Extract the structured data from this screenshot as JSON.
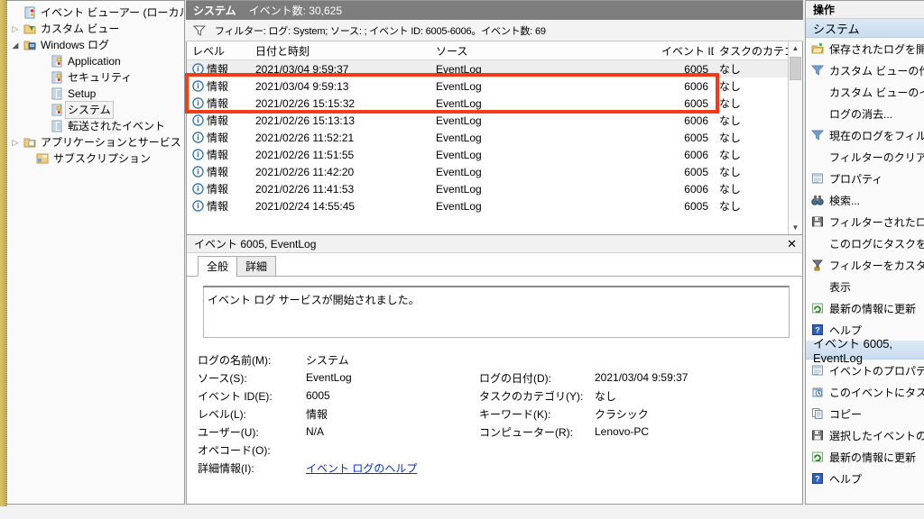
{
  "tree": {
    "items": [
      {
        "label": "イベント ビューアー (ローカル)",
        "icon": "event-viewer-icon",
        "indent": 1,
        "twisty": "none",
        "selected": false
      },
      {
        "label": "カスタム ビュー",
        "icon": "custom-view-folder-icon",
        "indent": 1,
        "twisty": "closed",
        "selected": false
      },
      {
        "label": "Windows ログ",
        "icon": "windows-log-folder-icon",
        "indent": 1,
        "twisty": "open",
        "selected": false
      },
      {
        "label": "Application",
        "icon": "log-icon",
        "indent": 3,
        "twisty": "none",
        "selected": false
      },
      {
        "label": "セキュリティ",
        "icon": "log-icon",
        "indent": 3,
        "twisty": "none",
        "selected": false
      },
      {
        "label": "Setup",
        "icon": "plain-log-icon",
        "indent": 3,
        "twisty": "none",
        "selected": false
      },
      {
        "label": "システム",
        "icon": "log-icon",
        "indent": 3,
        "twisty": "none",
        "selected": true
      },
      {
        "label": "転送されたイベント",
        "icon": "plain-log-icon",
        "indent": 3,
        "twisty": "none",
        "selected": false
      },
      {
        "label": "アプリケーションとサービス ログ",
        "icon": "app-service-folder-icon",
        "indent": 1,
        "twisty": "closed",
        "selected": false
      },
      {
        "label": "サブスクリプション",
        "icon": "subscription-icon",
        "indent": 2,
        "twisty": "none",
        "selected": false
      }
    ]
  },
  "center": {
    "header_title": "システム",
    "header_count": "イベント数: 30,625",
    "filter_icon": "filter-icon",
    "filter_text": "フィルター: ログ: System; ソース: ; イベント ID: 6005-6006。イベント数: 69",
    "columns": [
      "レベル",
      "日付と時刻",
      "ソース",
      "イベント ID",
      "タスクのカテゴリ"
    ],
    "rows": [
      {
        "level": "情報",
        "date": "2021/03/04 9:59:37",
        "source": "EventLog",
        "id": "6005",
        "task": "なし",
        "selected": true
      },
      {
        "level": "情報",
        "date": "2021/03/04 9:59:13",
        "source": "EventLog",
        "id": "6006",
        "task": "なし",
        "selected": false
      },
      {
        "level": "情報",
        "date": "2021/02/26 15:15:32",
        "source": "EventLog",
        "id": "6005",
        "task": "なし",
        "selected": false
      },
      {
        "level": "情報",
        "date": "2021/02/26 15:13:13",
        "source": "EventLog",
        "id": "6006",
        "task": "なし",
        "selected": false
      },
      {
        "level": "情報",
        "date": "2021/02/26 11:52:21",
        "source": "EventLog",
        "id": "6005",
        "task": "なし",
        "selected": false
      },
      {
        "level": "情報",
        "date": "2021/02/26 11:51:55",
        "source": "EventLog",
        "id": "6006",
        "task": "なし",
        "selected": false
      },
      {
        "level": "情報",
        "date": "2021/02/26 11:42:20",
        "source": "EventLog",
        "id": "6005",
        "task": "なし",
        "selected": false
      },
      {
        "level": "情報",
        "date": "2021/02/26 11:41:53",
        "source": "EventLog",
        "id": "6006",
        "task": "なし",
        "selected": false
      },
      {
        "level": "情報",
        "date": "2021/02/24 14:55:45",
        "source": "EventLog",
        "id": "6005",
        "task": "なし",
        "selected": false
      }
    ],
    "scroll_up": "▲",
    "scroll_down": "▼"
  },
  "detail": {
    "title": "イベント 6005, EventLog",
    "close_label": "✕",
    "tabs": [
      {
        "label": "全般",
        "active": true
      },
      {
        "label": "詳細",
        "active": false
      }
    ],
    "message": "イベント ログ サービスが開始されました。",
    "fields_left": [
      {
        "key": "ログの名前(M):",
        "value": "システム"
      },
      {
        "key": "ソース(S):",
        "value": "EventLog"
      },
      {
        "key": "イベント ID(E):",
        "value": "6005"
      },
      {
        "key": "レベル(L):",
        "value": "情報"
      },
      {
        "key": "ユーザー(U):",
        "value": "N/A"
      },
      {
        "key": "オペコード(O):",
        "value": ""
      },
      {
        "key": "詳細情報(I):",
        "value": "イベント ログのヘルプ",
        "link": true
      }
    ],
    "fields_right": [
      {
        "key": "ログの日付(D):",
        "value": "2021/03/04 9:59:37"
      },
      {
        "key": "タスクのカテゴリ(Y):",
        "value": "なし"
      },
      {
        "key": "キーワード(K):",
        "value": "クラシック"
      },
      {
        "key": "コンピューター(R):",
        "value": "Lenovo-PC"
      }
    ]
  },
  "actions": {
    "header": "操作",
    "group1_title": "システム",
    "group1_items": [
      {
        "label": "保存されたログを開く...",
        "icon": "open-folder-icon"
      },
      {
        "label": "カスタム ビューの作成...",
        "icon": "filter-icon"
      },
      {
        "label": "カスタム ビューのインポート...",
        "icon": "none"
      },
      {
        "label": "ログの消去...",
        "icon": "none"
      },
      {
        "label": "現在のログをフィルター...",
        "icon": "filter-icon"
      },
      {
        "label": "フィルターのクリア",
        "icon": "none"
      },
      {
        "label": "プロパティ",
        "icon": "properties-icon"
      },
      {
        "label": "検索...",
        "icon": "binoculars-icon"
      },
      {
        "label": "フィルターされたログ ファイルに名前を付けて保存...",
        "icon": "save-icon"
      },
      {
        "label": "このログにタスクを設定...",
        "icon": "none"
      },
      {
        "label": "フィルターをカスタム ビューに保存...",
        "icon": "custom-filter-icon"
      },
      {
        "label": "表示",
        "icon": "none"
      },
      {
        "label": "最新の情報に更新",
        "icon": "refresh-icon"
      },
      {
        "label": "ヘルプ",
        "icon": "help-icon"
      }
    ],
    "group2_title": "イベント 6005, EventLog",
    "group2_items": [
      {
        "label": "イベントのプロパティ",
        "icon": "properties-icon"
      },
      {
        "label": "このイベントにタスクを設定...",
        "icon": "task-clock-icon"
      },
      {
        "label": "コピー",
        "icon": "copy-icon"
      },
      {
        "label": "選択したイベントの保存...",
        "icon": "save-icon"
      },
      {
        "label": "最新の情報に更新",
        "icon": "refresh-icon"
      },
      {
        "label": "ヘルプ",
        "icon": "help-icon"
      }
    ]
  },
  "annotation": {
    "color": "#f23c16",
    "name": "highlight-rectangle"
  }
}
